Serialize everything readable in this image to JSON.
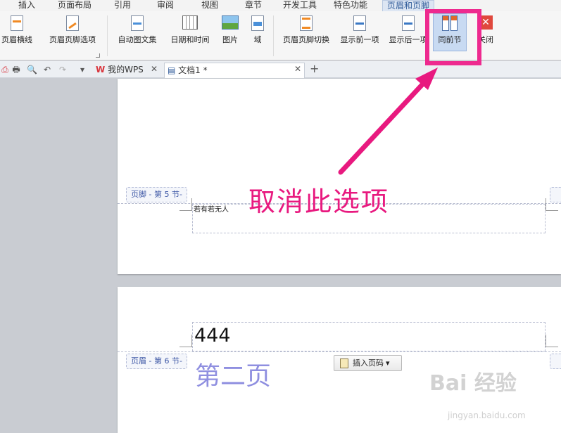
{
  "menu": {
    "tabs": [
      "插入",
      "页面布局",
      "引用",
      "审阅",
      "视图",
      "章节",
      "开发工具",
      "特色功能",
      "页眉和页脚"
    ]
  },
  "ribbon": {
    "buttons": [
      "页眉横线",
      "页眉页脚选项",
      "自动图文集",
      "日期和时间",
      "图片",
      "域",
      "页眉页脚切换",
      "显示前一项",
      "显示后一项",
      "同前节",
      "关闭"
    ]
  },
  "tabstrip": {
    "tab_wps": "我的WPS",
    "tab_doc": "文档1 *"
  },
  "document": {
    "footer_badge": "页脚 - 第 5 节-",
    "footer_text": "若有若无人",
    "header_badge": "页眉 - 第 6 节-",
    "header_text": "444",
    "insert_page_number": "插入页码",
    "watermark_text": "第二页"
  },
  "annotation": {
    "label": "取消此选项",
    "color": "#e8197f"
  },
  "watermark": {
    "brand": "Bai 经验",
    "url": "jingyan.baidu.com"
  }
}
